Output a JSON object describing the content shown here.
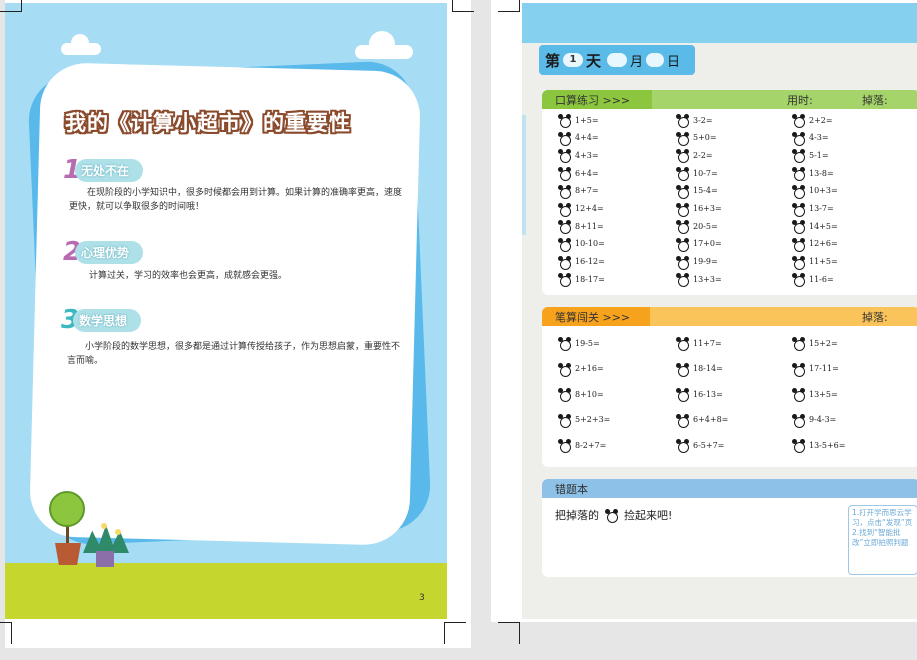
{
  "left_page": {
    "title": "我的《计算小超市》的重要性",
    "sections": [
      {
        "num": "1",
        "num_color": "#b76bb0",
        "heading": "无处不在",
        "body": "在现阶段的小学知识中，很多时候都会用到计算。如果计算的准确率更高，速度更快，就可以争取很多的时间哦！"
      },
      {
        "num": "2",
        "num_color": "#b76bb0",
        "heading": "心理优势",
        "body": "计算过关，学习的效率也会更高，成就感会更强。"
      },
      {
        "num": "3",
        "num_color": "#3cb8c0",
        "heading": "数学思想",
        "body": "小学阶段的数学思想，很多都是通过计算传授给孩子，作为思想启蒙，重要性不言而喻。"
      }
    ],
    "page_number": "3"
  },
  "right_page": {
    "day_prefix": "第",
    "day_value": "1",
    "day_suffix": "天",
    "month_label": "月",
    "date_label": "日",
    "oral": {
      "label": "口算练习 >>>",
      "time_label": "用时:",
      "drop_label": "掉落:",
      "columns": [
        [
          "1+5=",
          "4+4=",
          "4+3=",
          "6+4=",
          "8+7=",
          "12+4=",
          "8+11=",
          "10-10=",
          "16-12=",
          "18-17="
        ],
        [
          "3-2=",
          "5+0=",
          "2-2=",
          "10-7=",
          "15-4=",
          "16+3=",
          "20-5=",
          "17+0=",
          "19-9=",
          "13+3="
        ],
        [
          "2+2=",
          "4-3=",
          "5-1=",
          "13-8=",
          "10+3=",
          "13-7=",
          "14+5=",
          "12+6=",
          "11+5=",
          "11-6="
        ]
      ]
    },
    "written": {
      "label": "笔算闯关 >>>",
      "drop_label": "掉落:",
      "columns": [
        [
          "19-5=",
          "2+16=",
          "8+10=",
          "5+2+3=",
          "8-2+7="
        ],
        [
          "11+7=",
          "18-14=",
          "16-13=",
          "6+4+8=",
          "6-5+7="
        ],
        [
          "15+2=",
          "17-11=",
          "13+5=",
          "9-4-3=",
          "13-5+6="
        ]
      ]
    },
    "mistakes": {
      "label": "错题本",
      "text_before": "把掉落的",
      "text_after": "捡起来吧!",
      "tip": "1.打开学而思云学习，点击“发现”页 2.找到“智能批改”立即拍照判题"
    }
  },
  "colors": {
    "sky": "#a7dcf5",
    "grass": "#c5d72e",
    "oral_bar": "#8cc63f",
    "written_bar": "#f9b233",
    "mistake_bar": "#8dc1e8"
  }
}
